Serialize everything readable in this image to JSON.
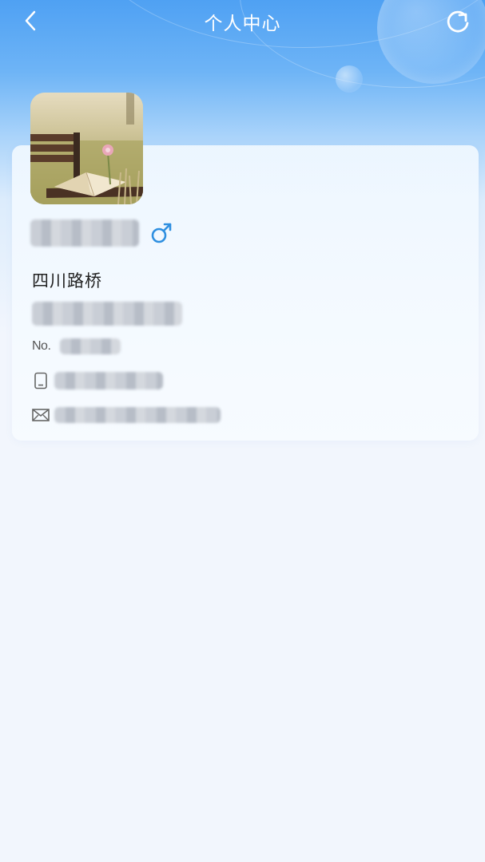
{
  "header": {
    "title": "个人中心",
    "back_icon": "chevron-left-icon",
    "refresh_icon": "refresh-icon"
  },
  "profile": {
    "avatar_description_icon": "avatar",
    "gender_symbol": "♂",
    "gender_color": "#2f8fe0",
    "school": "四川路桥",
    "id_label": "No.",
    "phone_icon": "phone-icon",
    "email_icon": "mail-icon"
  },
  "colors": {
    "header_gradient_top": "#4fa1f3",
    "page_background": "#f2f6fd",
    "accent": "#2f8fe0"
  }
}
